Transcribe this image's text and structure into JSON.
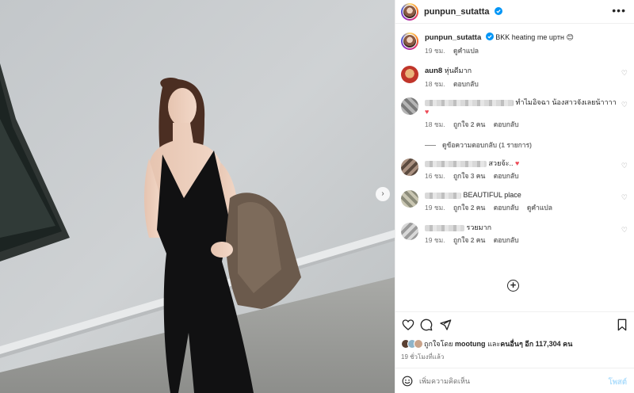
{
  "post": {
    "author": "punpun_sutatta",
    "verified": true
  },
  "caption": {
    "username": "punpun_sutatta",
    "text": "BKK heating me upтн",
    "emoji": "😊",
    "time": "19 ชม.",
    "translate": "ดูคำแปล"
  },
  "comments": [
    {
      "username": "aun8",
      "text": "หุ่นดีมาก",
      "time": "18 ชม.",
      "likes": "",
      "reply": "ตอบกลับ",
      "translate": ""
    },
    {
      "username": "",
      "text": "ทำไมอิจฉา น้องสาวจังเลยน้าาาา",
      "heart": "♥",
      "time": "18 ชม.",
      "likes": "ถูกใจ 2 คน",
      "reply": "ตอบกลับ",
      "translate": ""
    },
    {
      "username": "",
      "text": "สวยจ้ะ..",
      "heart": "♥",
      "time": "16 ชม.",
      "likes": "ถูกใจ 3 คน",
      "reply": "ตอบกลับ",
      "translate": ""
    },
    {
      "username": "",
      "text": "BEAUTIFUL place",
      "time": "19 ชม.",
      "likes": "ถูกใจ 2 คน",
      "reply": "ตอบกลับ",
      "translate": "ดูคำแปล"
    },
    {
      "username": "",
      "text": "รวยมาก",
      "time": "19 ชม.",
      "likes": "ถูกใจ 2 คน",
      "reply": "ตอบกลับ",
      "translate": ""
    }
  ],
  "view_replies": "ดูข้อความตอบกลับ (1 รายการ)",
  "likes": {
    "prefix": "ถูกใจโดย",
    "first_user": "mootung",
    "middle": "และ",
    "others": "คนอื่นๆ อีก 117,304 คน"
  },
  "posted_time": "19 ชั่วโมงที่แล้ว",
  "add_comment": {
    "placeholder": "เพิ่มความคิดเห็น",
    "post_label": "โพสต์"
  },
  "icons": {
    "heart": "heart-icon",
    "comment": "comment-icon",
    "share": "share-icon",
    "save": "bookmark-icon",
    "emoji": "emoji-icon",
    "more": "more-icon",
    "add": "add-circle-icon"
  },
  "colors": {
    "link_post_button": "#b2dffc",
    "heart_red": "#ed4956",
    "verified_blue": "#0095f6"
  }
}
